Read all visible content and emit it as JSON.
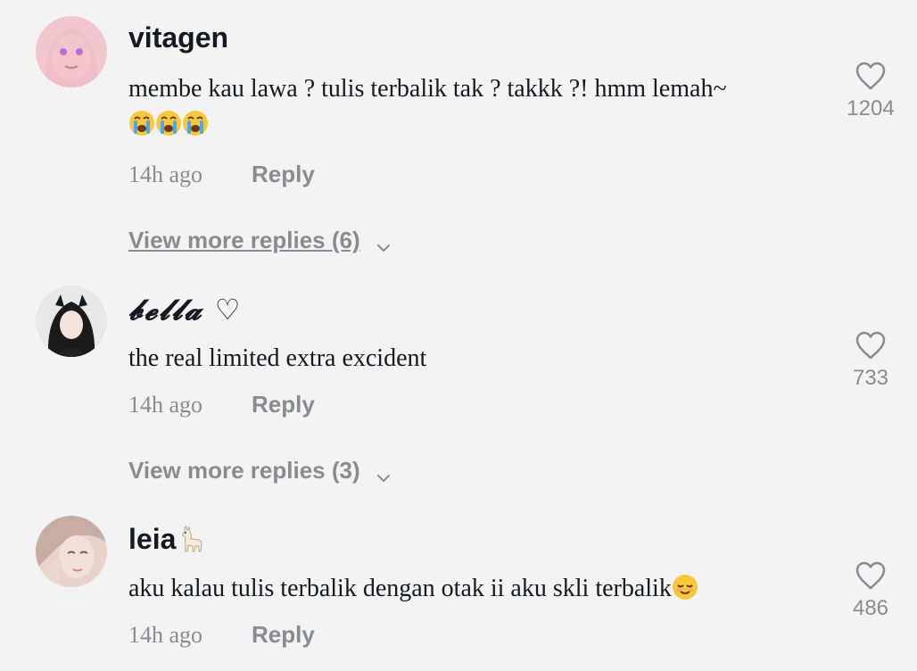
{
  "comments": [
    {
      "username": "vitagen",
      "text": "membe kau lawa ? tulis terbalik tak ? takkk ?! hmm lemah~",
      "emojis": [
        "crying-face",
        "crying-face",
        "crying-face"
      ],
      "time": "14h ago",
      "reply_label": "Reply",
      "view_more": "View more replies (6)",
      "likes": "1204"
    },
    {
      "username": "𝓫𝓮𝓵𝓵𝓪 ♡",
      "text": "the real limited extra excident",
      "time": "14h ago",
      "reply_label": "Reply",
      "view_more": "View more replies (3)",
      "likes": "733"
    },
    {
      "username": "leia",
      "username_emoji": "llama",
      "text": "aku kalau tulis terbalik dengan otak ii aku skli terbalik",
      "text_emoji": "relieved-face",
      "time": "14h ago",
      "reply_label": "Reply",
      "likes": "486"
    }
  ],
  "colors": {
    "background": "#f3f3f3",
    "text_primary": "#161823",
    "text_secondary": "#8a8b91"
  }
}
